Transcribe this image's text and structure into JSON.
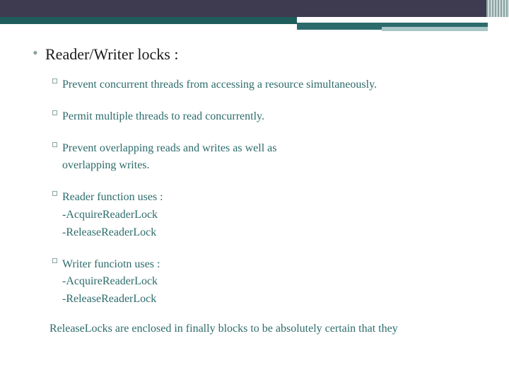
{
  "heading": "Reader/Writer locks :",
  "bullets": [
    {
      "lines": [
        "Prevent concurrent threads from accessing a resource simultaneously."
      ]
    },
    {
      "lines": [
        "Permit multiple threads to read concurrently."
      ]
    },
    {
      "lines": [
        "Prevent overlapping reads and writes as well as",
        "overlapping writes."
      ]
    },
    {
      "lines": [
        "Reader function uses  :",
        "-AcquireReaderLock",
        "-ReleaseReaderLock"
      ]
    },
    {
      "lines": [
        "Writer funciotn uses :",
        "-AcquireReaderLock",
        "-ReleaseReaderLock"
      ]
    }
  ],
  "footnote": "ReleaseLocks  are enclosed in finally  blocks to be absolutely certain that they"
}
